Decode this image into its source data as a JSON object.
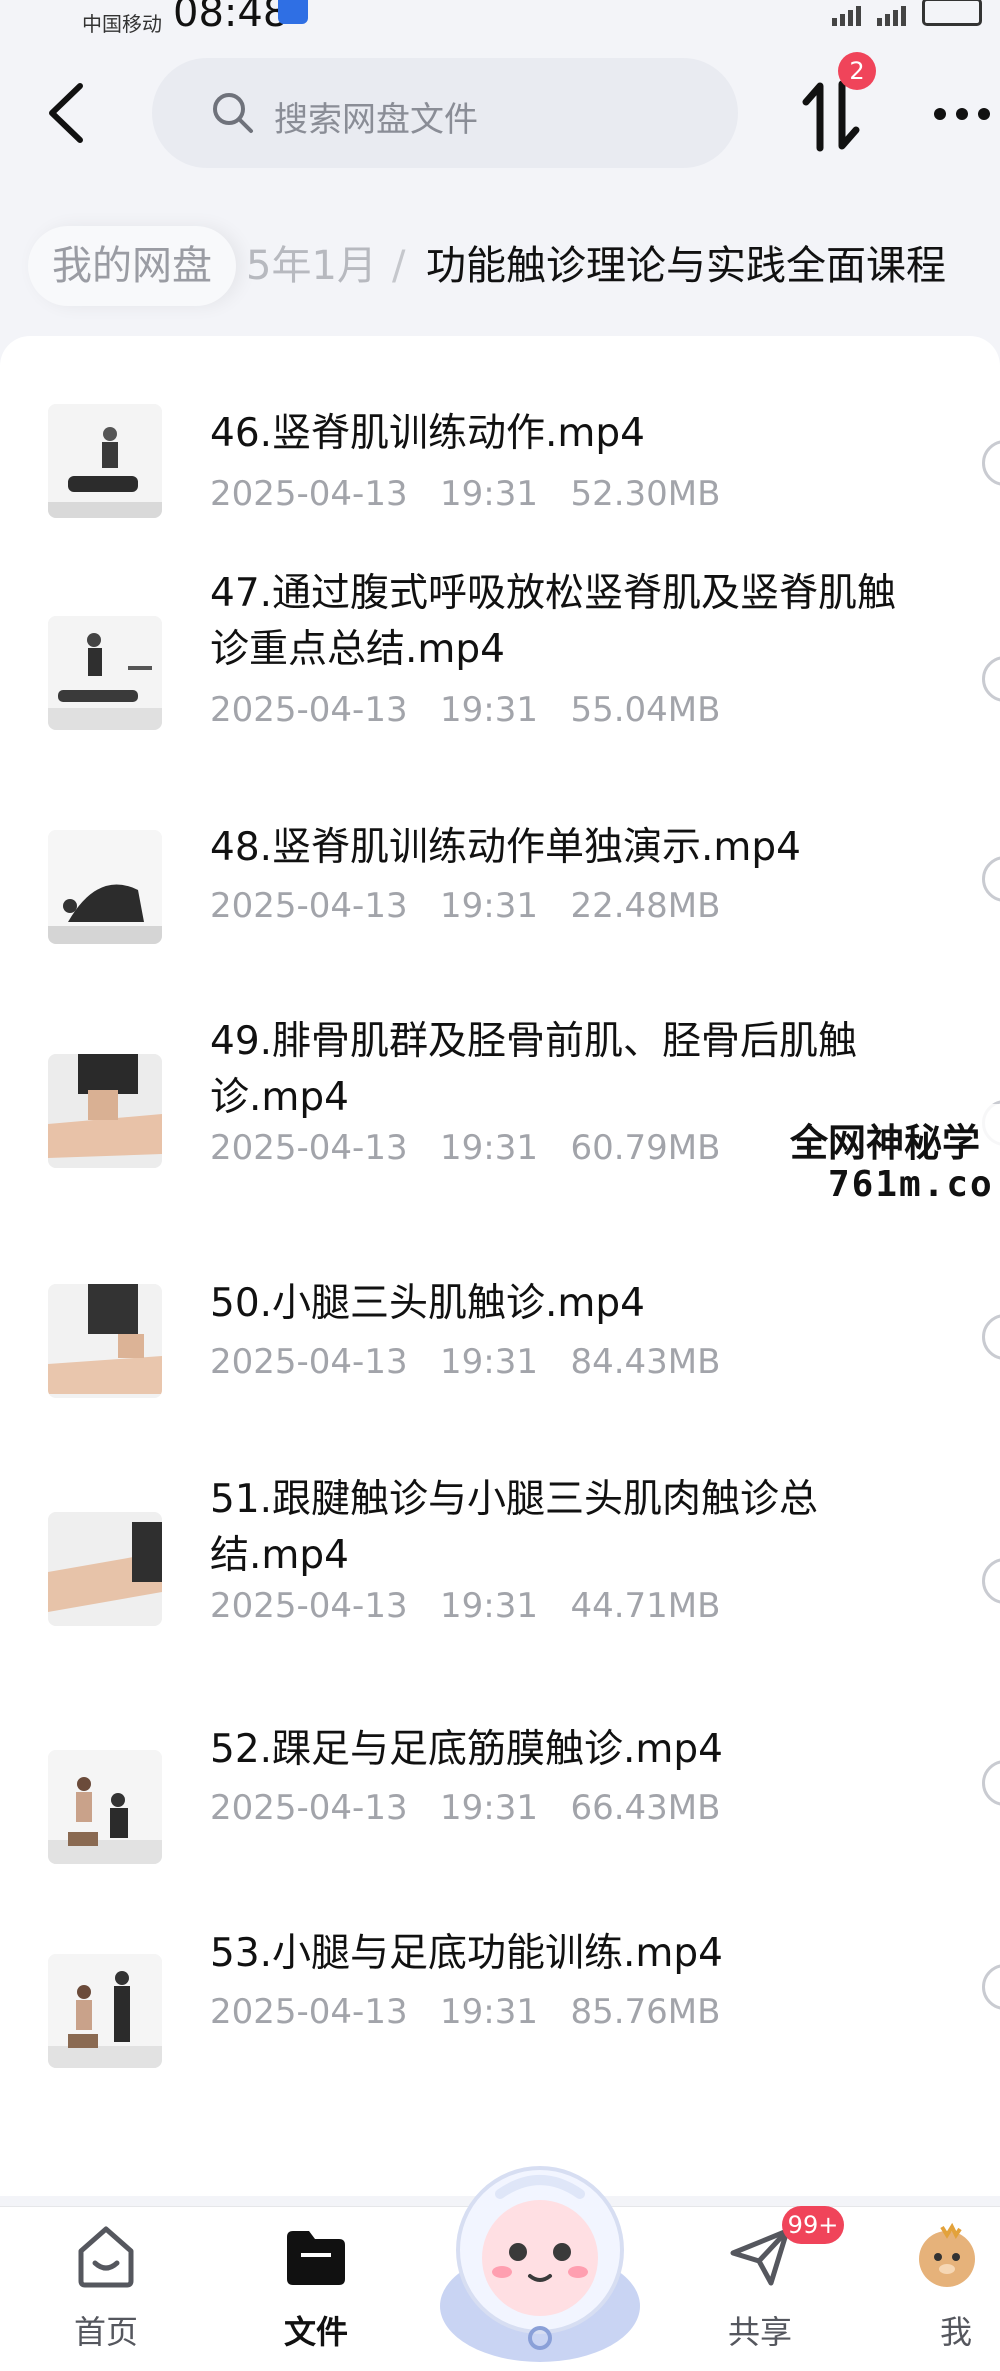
{
  "status_bar": {
    "carrier": "中国移动",
    "time": "08:48"
  },
  "search": {
    "placeholder": "搜索网盘文件"
  },
  "transfer": {
    "badge": "2"
  },
  "breadcrumb": {
    "root": "我的网盘",
    "middle": "5年1月",
    "separator": "/",
    "current": "功能触诊理论与实践全面课程"
  },
  "files": [
    {
      "name": "46.竖脊肌训练动作.mp4",
      "date": "2025-04-13",
      "time": "19:31",
      "size": "52.30MB"
    },
    {
      "name": "47.通过腹式呼吸放松竖脊肌及竖脊肌触诊重点总结.mp4",
      "date": "2025-04-13",
      "time": "19:31",
      "size": "55.04MB"
    },
    {
      "name": "48.竖脊肌训练动作单独演示.mp4",
      "date": "2025-04-13",
      "time": "19:31",
      "size": "22.48MB"
    },
    {
      "name": "49.腓骨肌群及胫骨前肌、胫骨后肌触诊.mp4",
      "date": "2025-04-13",
      "time": "19:31",
      "size": "60.79MB"
    },
    {
      "name": "50.小腿三头肌触诊.mp4",
      "date": "2025-04-13",
      "time": "19:31",
      "size": "84.43MB"
    },
    {
      "name": "51.跟腱触诊与小腿三头肌肉触诊总结.mp4",
      "date": "2025-04-13",
      "time": "19:31",
      "size": "44.71MB"
    },
    {
      "name": "52.踝足与足底筋膜触诊.mp4",
      "date": "2025-04-13",
      "time": "19:31",
      "size": "66.43MB"
    },
    {
      "name": "53.小腿与足底功能训练.mp4",
      "date": "2025-04-13",
      "time": "19:31",
      "size": "85.76MB"
    }
  ],
  "watermark": {
    "line1": "全网神秘学",
    "line2": "761m.co"
  },
  "bottom_nav": {
    "home": "首页",
    "files": "文件",
    "share": "共享",
    "share_badge": "99+",
    "mine": "我的"
  },
  "colors": {
    "badge": "#f0445a",
    "accent_blue": "#2f6fe4",
    "meta_text": "#a2a4aa"
  }
}
